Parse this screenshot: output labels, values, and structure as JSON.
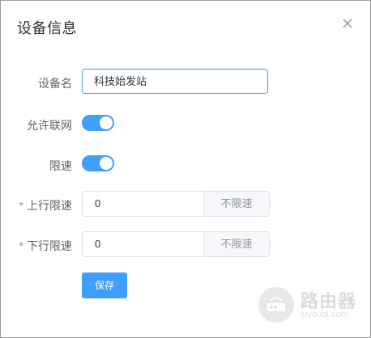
{
  "dialog": {
    "title": "设备信息"
  },
  "form": {
    "device_name": {
      "label": "设备名",
      "value": "科技始发站"
    },
    "allow_network": {
      "label": "允许联网",
      "enabled": true
    },
    "speed_limit": {
      "label": "限速",
      "enabled": true
    },
    "upload_limit": {
      "label": "上行限速",
      "required_mark": "*",
      "value": "0",
      "append": "不限速"
    },
    "download_limit": {
      "label": "下行限速",
      "required_mark": "*",
      "value": "0",
      "append": "不限速"
    },
    "save_label": "保存"
  },
  "watermark": {
    "text": "路由器",
    "subtext": "luyouqi.com"
  },
  "colors": {
    "primary": "#409eff",
    "required": "#f56c6c",
    "border": "#dcdfe6"
  },
  "icons": {
    "close": "close-icon",
    "watermark": "router-icon"
  }
}
